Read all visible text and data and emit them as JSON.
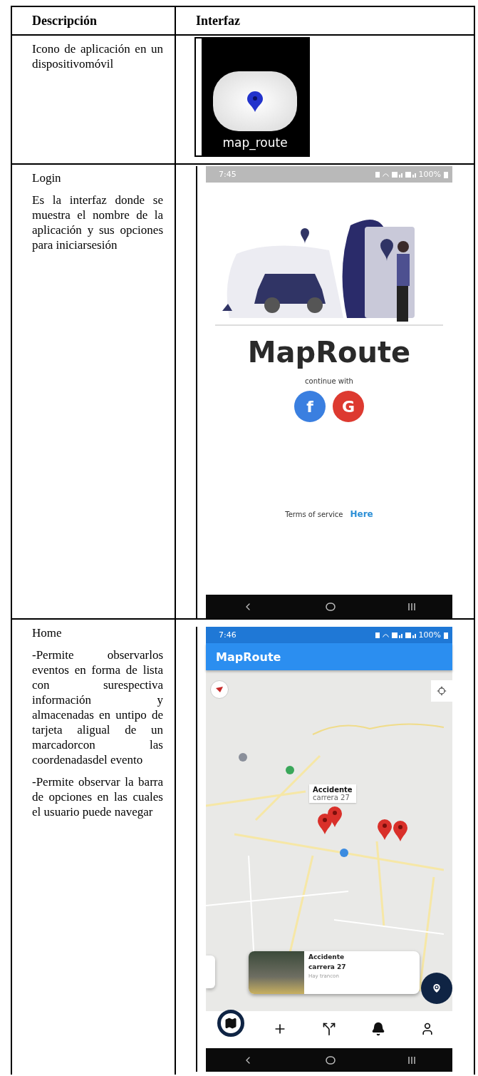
{
  "table": {
    "columns": [
      "Descripción",
      "Interfaz"
    ],
    "rows": [
      {
        "description": [
          "Icono de aplicación en un dispositivomóvil"
        ],
        "interface": {
          "kind": "app_icon",
          "label": "map_route"
        }
      },
      {
        "description": [
          "Login",
          "Es la interfaz donde se muestra el nombre de la aplicación y sus opciones para iniciarsesión"
        ],
        "interface": {
          "kind": "login",
          "status_time": "7:45",
          "battery": "100%",
          "app_name": "MapRoute",
          "prompt": "continue with",
          "social_buttons": [
            {
              "kind": "facebook",
              "label": "f"
            },
            {
              "kind": "google",
              "label": "G"
            }
          ],
          "terms": "Terms of service",
          "terms_link": "Here"
        }
      },
      {
        "description": [
          "Home",
          "-Permite observarlos eventos en forma de lista con surespectiva información y almacenadas en untipo de tarjeta aligual de un marcadorcon las coordenadasdel evento",
          "-Permite observar la barra de opciones en las cuales el usuario puede navegar"
        ],
        "interface": {
          "kind": "home",
          "status_time": "7:46",
          "battery": "100%",
          "title": "MapRoute",
          "tooltip": {
            "title": "Accidente",
            "subtitle": "carrera 27"
          },
          "card": {
            "title": "Accidente",
            "subtitle": "carrera 27",
            "note": "Hay trancon"
          },
          "nav_items": [
            {
              "kind": "map",
              "selected": true
            },
            {
              "kind": "add",
              "selected": false
            },
            {
              "kind": "route",
              "selected": false
            },
            {
              "kind": "bell",
              "selected": false
            },
            {
              "kind": "profile",
              "selected": false
            }
          ]
        }
      }
    ]
  }
}
